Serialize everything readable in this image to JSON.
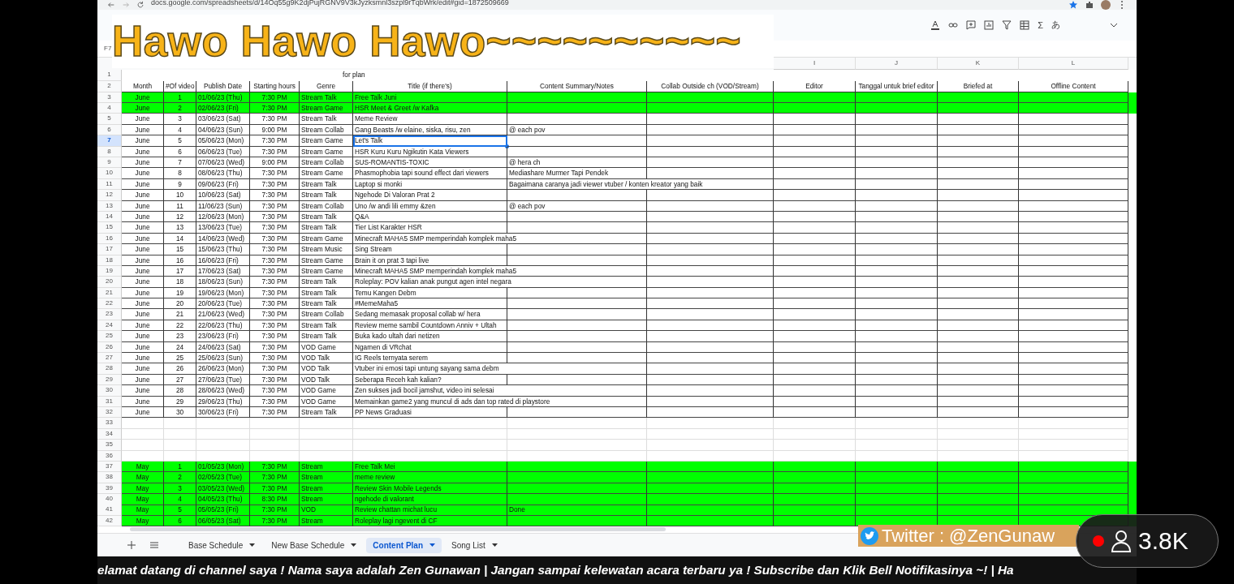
{
  "browser": {
    "url": "docs.google.com/spreadsheets/d/14Oq55g9K2djPujRGNV9V3kJyzksmnl3szpl9rTqbWrk/edit#gid=1872509669"
  },
  "banner": {
    "text": "Hawo Hawo Hawo~~~~~~~~~~"
  },
  "toolbar": {
    "function_symbol": "Σ",
    "input_tools_symbol": "あ"
  },
  "name_box": "F7",
  "column_letters": [
    "I",
    "J",
    "K",
    "L"
  ],
  "note_row": {
    "number": "1",
    "note": "for plan"
  },
  "header_row": {
    "number": "2",
    "headers": [
      "Month",
      "#Of video",
      "Publish Date",
      "Starting hours",
      "Genre",
      "Title (if there's)",
      "Content Summary/Notes",
      "Collab Outside ch (VOD/Stream)",
      "Editor",
      "Tanggal untuk brief editor",
      "Briefed at",
      "Offline Content"
    ]
  },
  "rows": [
    {
      "number": "3",
      "month": "June",
      "video": "1",
      "date": "01/06/23 (Thu)",
      "time": "7:30 PM",
      "genre": "Stream Talk",
      "title": "Free Talk Juni",
      "highlighted": true,
      "selected": false
    },
    {
      "number": "4",
      "month": "June",
      "video": "2",
      "date": "02/06/23 (Fri)",
      "time": "7:30 PM",
      "genre": "Stream Game",
      "title": "HSR Meet & Greet /w Kafka",
      "highlighted": true,
      "selected": false
    },
    {
      "number": "5",
      "month": "June",
      "video": "3",
      "date": "03/06/23 (Sat)",
      "time": "7:30 PM",
      "genre": "Stream Talk",
      "title": "Meme Review",
      "highlighted": false,
      "selected": false
    },
    {
      "number": "6",
      "month": "June",
      "video": "4",
      "date": "04/06/23 (Sun)",
      "time": "9:00 PM",
      "genre": "Stream Collab",
      "title": "Gang Beasts /w elaine, siska, risu, zen",
      "summary": "@ each pov",
      "highlighted": false,
      "selected": false
    },
    {
      "number": "7",
      "month": "June",
      "video": "5",
      "date": "05/06/23 (Mon)",
      "time": "7:30 PM",
      "genre": "Stream Game",
      "title": "Let's Talk",
      "highlighted": false,
      "selected": true
    },
    {
      "number": "8",
      "month": "June",
      "video": "6",
      "date": "06/06/23 (Tue)",
      "time": "7:30 PM",
      "genre": "Stream Game",
      "title": "HSR Kuru Kuru Ngikutin Kata Viewers",
      "highlighted": false,
      "selected": false
    },
    {
      "number": "9",
      "month": "June",
      "video": "7",
      "date": "07/06/23 (Wed)",
      "time": "9:00 PM",
      "genre": "Stream Collab",
      "title": "SUS-ROMANTIS-TOXIC",
      "summary": "@ hera ch",
      "highlighted": false,
      "selected": false
    },
    {
      "number": "10",
      "month": "June",
      "video": "8",
      "date": "08/06/23 (Thu)",
      "time": "7:30 PM",
      "genre": "Stream Game",
      "title": "Phasmophobia tapi sound effect dari viewers",
      "summary": "Mediashare Murmer Tapi Pendek",
      "highlighted": false,
      "selected": false
    },
    {
      "number": "11",
      "month": "June",
      "video": "9",
      "date": "09/06/23 (Fri)",
      "time": "7:30 PM",
      "genre": "Stream Talk",
      "title": "Laptop si monki",
      "summary": "Bagaimana caranya jadi viewer vtuber / konten kreator yang baik",
      "highlighted": false,
      "selected": false
    },
    {
      "number": "12",
      "month": "June",
      "video": "10",
      "date": "10/06/23 (Sat)",
      "time": "7:30 PM",
      "genre": "Stream Talk",
      "title": "Ngehode Di Valoran Prat 2",
      "highlighted": false,
      "selected": false
    },
    {
      "number": "13",
      "month": "June",
      "video": "11",
      "date": "11/06/23 (Sun)",
      "time": "7:30 PM",
      "genre": "Stream Collab",
      "title": "Uno /w andi lili emmy &zen",
      "summary": "@ each pov",
      "highlighted": false,
      "selected": false
    },
    {
      "number": "14",
      "month": "June",
      "video": "12",
      "date": "12/06/23 (Mon)",
      "time": "7:30 PM",
      "genre": "Stream Talk",
      "title": "Q&A",
      "highlighted": false,
      "selected": false
    },
    {
      "number": "15",
      "month": "June",
      "video": "13",
      "date": "13/06/23 (Tue)",
      "time": "7:30 PM",
      "genre": "Stream Talk",
      "title": "Tier List Karakter HSR",
      "highlighted": false,
      "selected": false
    },
    {
      "number": "16",
      "month": "June",
      "video": "14",
      "date": "14/06/23 (Wed)",
      "time": "7:30 PM",
      "genre": "Stream Game",
      "title": "Minecraft MAHA5 SMP memperindah komplek maha5",
      "highlighted": false,
      "selected": false
    },
    {
      "number": "17",
      "month": "June",
      "video": "15",
      "date": "15/06/23 (Thu)",
      "time": "7:30 PM",
      "genre": "Stream Music",
      "title": "Sing Stream",
      "highlighted": false,
      "selected": false
    },
    {
      "number": "18",
      "month": "June",
      "video": "16",
      "date": "16/06/23 (Fri)",
      "time": "7:30 PM",
      "genre": "Stream Game",
      "title": "Brain it on prat 3 tapi live",
      "highlighted": false,
      "selected": false
    },
    {
      "number": "19",
      "month": "June",
      "video": "17",
      "date": "17/06/23 (Sat)",
      "time": "7:30 PM",
      "genre": "Stream Game",
      "title": "Minecraft MAHA5 SMP memperindah komplek maha5",
      "highlighted": false,
      "selected": false
    },
    {
      "number": "20",
      "month": "June",
      "video": "18",
      "date": "18/06/23 (Sun)",
      "time": "7:30 PM",
      "genre": "Stream Talk",
      "title": "Roleplay: POV kalian anak pungut agen intel negara",
      "highlighted": false,
      "selected": false
    },
    {
      "number": "21",
      "month": "June",
      "video": "19",
      "date": "19/06/23 (Mon)",
      "time": "7:30 PM",
      "genre": "Stream Talk",
      "title": "Temu Kangen Debm",
      "highlighted": false,
      "selected": false
    },
    {
      "number": "22",
      "month": "June",
      "video": "20",
      "date": "20/06/23 (Tue)",
      "time": "7:30 PM",
      "genre": "Stream Talk",
      "title": "#MemeMaha5",
      "highlighted": false,
      "selected": false
    },
    {
      "number": "23",
      "month": "June",
      "video": "21",
      "date": "21/06/23 (Wed)",
      "time": "7:30 PM",
      "genre": "Stream Collab",
      "title": "Sedang memasak proposal collab w/ hera",
      "highlighted": false,
      "selected": false
    },
    {
      "number": "24",
      "month": "June",
      "video": "22",
      "date": "22/06/23 (Thu)",
      "time": "7:30 PM",
      "genre": "Stream Talk",
      "title": "Review meme sambil Countdown Anniv + Ultah",
      "highlighted": false,
      "selected": false
    },
    {
      "number": "25",
      "month": "June",
      "video": "23",
      "date": "23/06/23 (Fri)",
      "time": "7:30 PM",
      "genre": "Stream Talk",
      "title": "Buka kado ultah dari netizen",
      "highlighted": false,
      "selected": false
    },
    {
      "number": "26",
      "month": "June",
      "video": "24",
      "date": "24/06/23 (Sat)",
      "time": "7:30 PM",
      "genre": "VOD Game",
      "title": "Ngamen di VRchat",
      "highlighted": false,
      "selected": false
    },
    {
      "number": "27",
      "month": "June",
      "video": "25",
      "date": "25/06/23 (Sun)",
      "time": "7:30 PM",
      "genre": "VOD Talk",
      "title": "IG Reels ternyata serem",
      "highlighted": false,
      "selected": false
    },
    {
      "number": "28",
      "month": "June",
      "video": "26",
      "date": "26/06/23 (Mon)",
      "time": "7:30 PM",
      "genre": "VOD Talk",
      "title": "Vtuber ini emosi tapi untung sayang sama debm",
      "highlighted": false,
      "selected": false
    },
    {
      "number": "29",
      "month": "June",
      "video": "27",
      "date": "27/06/23 (Tue)",
      "time": "7:30 PM",
      "genre": "VOD Talk",
      "title": "Seberapa Receh kah kalian?",
      "highlighted": false,
      "selected": false
    },
    {
      "number": "30",
      "month": "June",
      "video": "28",
      "date": "28/06/23 (Wed)",
      "time": "7:30 PM",
      "genre": "VOD Game",
      "title": "Zen sukses jadi bocil jamshut, video ini selesai",
      "highlighted": false,
      "selected": false
    },
    {
      "number": "31",
      "month": "June",
      "video": "29",
      "date": "29/06/23 (Thu)",
      "time": "7:30 PM",
      "genre": "VOD Game",
      "title": "Memainkan game2 yang muncul di ads dan top rated di playstore",
      "highlighted": false,
      "selected": false
    },
    {
      "number": "32",
      "month": "June",
      "video": "30",
      "date": "30/06/23 (Fri)",
      "time": "7:30 PM",
      "genre": "Stream Talk",
      "title": "PP News Graduasi",
      "highlighted": false,
      "selected": false
    },
    {
      "number": "33",
      "highlighted": false,
      "selected": false
    },
    {
      "number": "34",
      "highlighted": false,
      "selected": false
    },
    {
      "number": "35",
      "highlighted": false,
      "selected": false
    },
    {
      "number": "36",
      "highlighted": false,
      "selected": false
    },
    {
      "number": "37",
      "month": "May",
      "video": "1",
      "date": "01/05/23 (Mon)",
      "time": "7:30 PM",
      "genre": "Stream",
      "title": "Free Talk Mei",
      "highlighted": true,
      "selected": false
    },
    {
      "number": "38",
      "month": "May",
      "video": "2",
      "date": "02/05/23 (Tue)",
      "time": "7:30 PM",
      "genre": "Stream",
      "title": "meme review",
      "highlighted": true,
      "selected": false
    },
    {
      "number": "39",
      "month": "May",
      "video": "3",
      "date": "03/05/23 (Wed)",
      "time": "7:30 PM",
      "genre": "Stream",
      "title": "Review Skin Mobile Legends",
      "highlighted": true,
      "selected": false
    },
    {
      "number": "40",
      "month": "May",
      "video": "4",
      "date": "04/05/23 (Thu)",
      "time": "8:30 PM",
      "genre": "Stream",
      "title": "ngehode di valorant",
      "highlighted": true,
      "selected": false
    },
    {
      "number": "41",
      "month": "May",
      "video": "5",
      "date": "05/05/23 (Fri)",
      "time": "7:30 PM",
      "genre": "VOD",
      "title": "Review chattan michat lucu",
      "summary": "Done",
      "highlighted": true,
      "selected": false
    },
    {
      "number": "42",
      "month": "May",
      "video": "6",
      "date": "06/05/23 (Sat)",
      "time": "7:30 PM",
      "genre": "Stream",
      "title": "Roleplay lagi ngevent di CF",
      "highlighted": true,
      "selected": false
    }
  ],
  "sheet_tabs": [
    {
      "label": "Base Schedule",
      "selected": false
    },
    {
      "label": "New Base Schedule",
      "selected": false
    },
    {
      "label": "Content Plan",
      "selected": true
    },
    {
      "label": "Song List",
      "selected": false
    }
  ],
  "twitter_overlay": {
    "text": "Twitter : @ZenGunaw"
  },
  "live_viewers": {
    "count": "3.8K"
  },
  "ticker": {
    "text": "elamat datang di channel saya ! Nama saya adalah Zen Gunawan | Jangan sampai kelewatan acara terbaru ya ! Subscribe dan Klik Bell Notifikasinya ~! | Ha"
  }
}
